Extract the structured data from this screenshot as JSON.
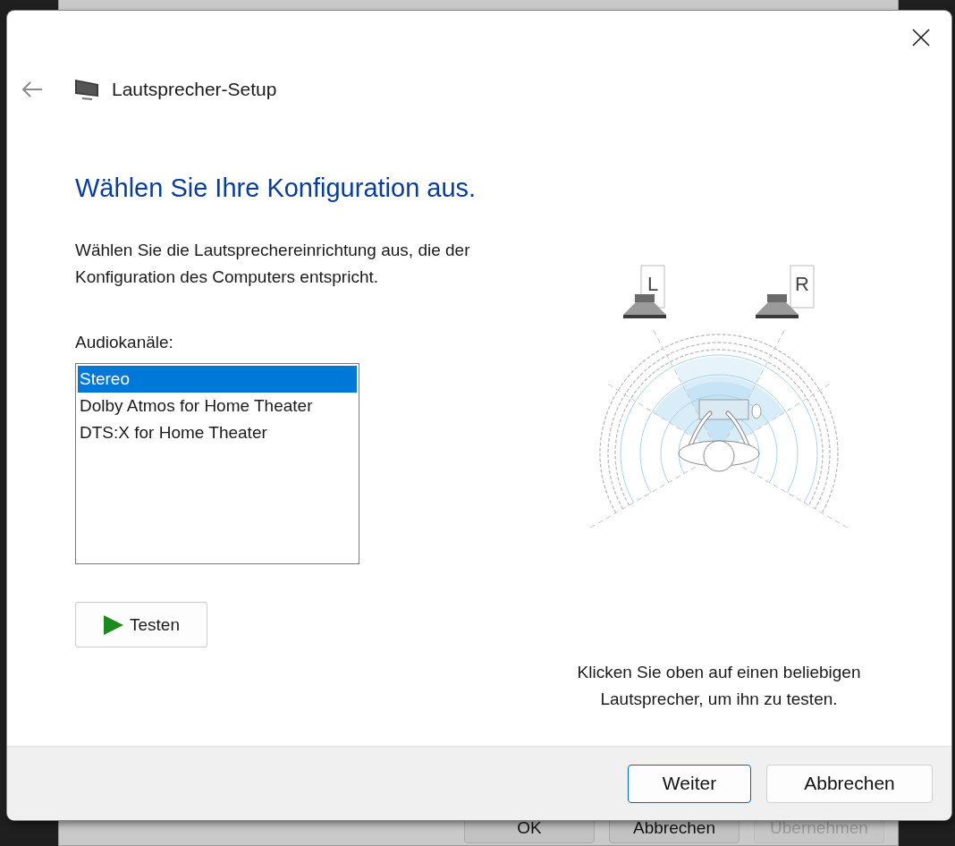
{
  "background_window": {
    "buttons": [
      {
        "label": "OK",
        "disabled": false
      },
      {
        "label": "Abbrechen",
        "disabled": false
      },
      {
        "label": "Übernehmen",
        "disabled": true
      }
    ]
  },
  "window": {
    "title": "Lautsprecher-Setup"
  },
  "heading": "Wählen Sie Ihre Konfiguration aus.",
  "description": "Wählen Sie die Lautsprechereinrichtung aus, die der Konfiguration des Computers entspricht.",
  "channels_label": "Audiokanäle:",
  "channels": [
    {
      "label": "Stereo",
      "selected": true
    },
    {
      "label": "Dolby Atmos for Home Theater",
      "selected": false
    },
    {
      "label": "DTS:X for Home Theater",
      "selected": false
    }
  ],
  "test_button": "Testen",
  "speakers": [
    {
      "label": "L"
    },
    {
      "label": "R"
    }
  ],
  "hint": "Klicken Sie oben auf einen beliebigen Lautsprecher, um ihn zu testen.",
  "buttons": [
    {
      "label": "Weiter",
      "default": true
    },
    {
      "label": "Abbrechen",
      "default": false
    }
  ]
}
